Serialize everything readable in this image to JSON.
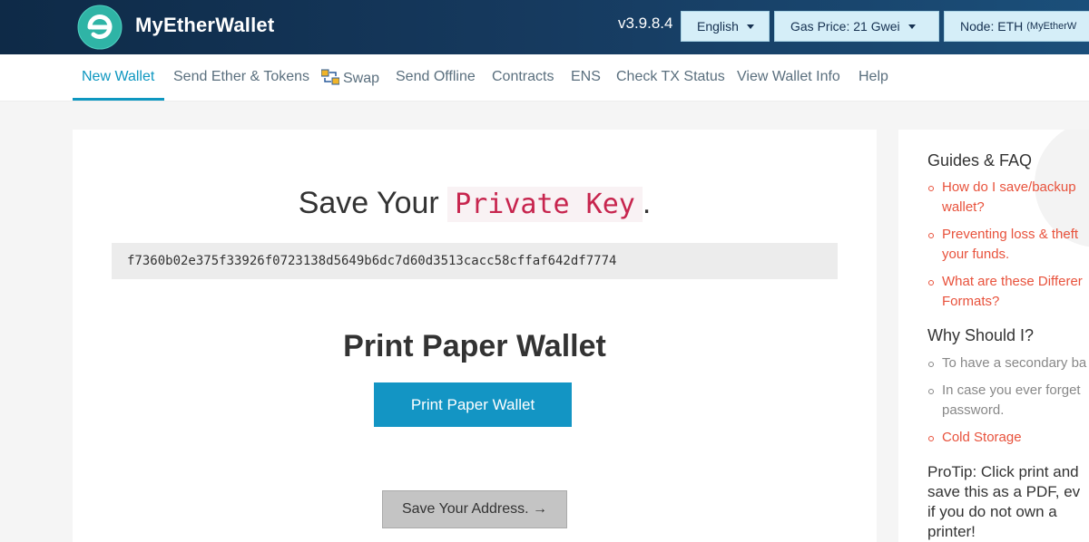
{
  "header": {
    "brand": "MyEtherWallet",
    "version": "v3.9.8.4",
    "language_label": "English",
    "gas_price_label": "Gas Price: 21 Gwei",
    "node_label": "Node: ETH",
    "node_sub": "(MyEtherW"
  },
  "nav": {
    "items": [
      {
        "label": "New Wallet"
      },
      {
        "label": "Send Ether & Tokens"
      },
      {
        "label": "Swap"
      },
      {
        "label": "Send Offline"
      },
      {
        "label": "Contracts"
      },
      {
        "label": "ENS"
      },
      {
        "label": "Check TX Status"
      },
      {
        "label": "View Wallet Info"
      },
      {
        "label": "Help"
      }
    ]
  },
  "main": {
    "save_heading": "Save Your",
    "save_heading_code": "Private Key",
    "save_heading_end": ".",
    "private_key": "f7360b02e375f33926f0723138d5649b6dc7d60d3513cacc58cffaf642df7774",
    "print_heading": "Print Paper Wallet",
    "print_button": "Print Paper Wallet",
    "address_button": "Save Your Address. →"
  },
  "sidebar": {
    "guides_heading": "Guides & FAQ",
    "guides": [
      {
        "line1": "How do I save/backup",
        "line2": "wallet?"
      },
      {
        "line1": "Preventing loss & theft",
        "line2": "your funds."
      },
      {
        "line1": "What are these Differer",
        "line2": "Formats?"
      }
    ],
    "why_heading": "Why Should I?",
    "why": [
      {
        "line1": "To have a secondary ba",
        "line2": ""
      },
      {
        "line1": "In case you ever forget",
        "line2": "password."
      },
      {
        "line1": "Cold Storage",
        "line2": ""
      }
    ],
    "protip": [
      "ProTip: Click print and",
      "save this as a PDF, ev",
      "if you do not own a",
      "printer!"
    ]
  },
  "colors": {
    "header_bg": "#163a5f",
    "accent": "#1395c4",
    "link": "#e8523c",
    "code_text": "#c7254e"
  }
}
